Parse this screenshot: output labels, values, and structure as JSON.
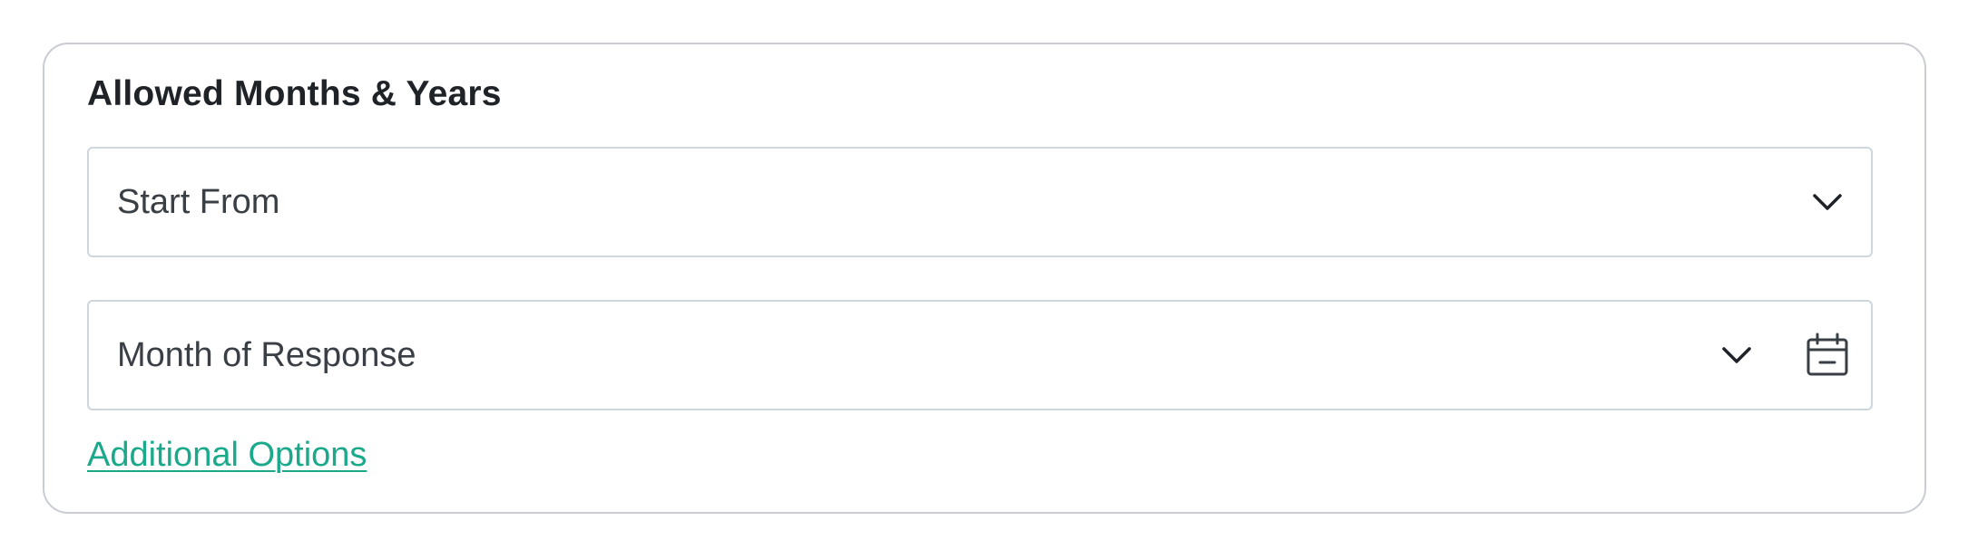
{
  "section": {
    "title": "Allowed Months & Years"
  },
  "fields": {
    "start_from": {
      "value": "Start From",
      "icon": "chevron-down-icon"
    },
    "month": {
      "value": "Month of Response",
      "icon": "chevron-down-icon",
      "secondary_icon": "calendar-icon"
    }
  },
  "links": {
    "additional_options": "Additional Options"
  },
  "colors": {
    "link": "#1aa98a",
    "border": "#ced6de",
    "card_border": "#c9cdd3",
    "text": "#3a3f45"
  }
}
